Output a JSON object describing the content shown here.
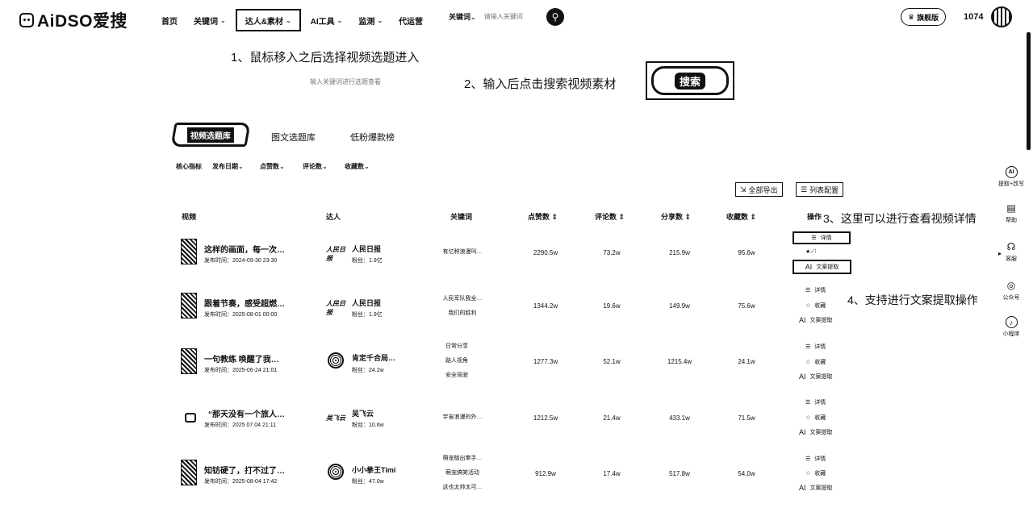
{
  "brand": {
    "logo_text": "AiDSO爱搜"
  },
  "nav": {
    "home": "首页",
    "keywords": "关键词",
    "creators": "达人&素材",
    "ai_tools": "AI工具",
    "monitor": "监测",
    "agency": "代运营"
  },
  "search": {
    "type_label": "关键词",
    "placeholder": "请输入关键词"
  },
  "user": {
    "vip_label": "旗舰版",
    "points": "1074"
  },
  "annotations": {
    "step1": "1、鼠标移入之后选择视频选题进入",
    "step1_hint": "输入关键词进行选题查看",
    "step2": "2、输入后点击搜索视频素材",
    "step2_button": "搜索",
    "step3": "3、这里可以进行查看视频详情",
    "step4": "4、支持进行文案提取操作"
  },
  "tabs": [
    "视频选题库",
    "图文选题库",
    "低粉爆款榜"
  ],
  "filters": [
    "核心指标",
    "发布日期",
    "点赞数",
    "评论数",
    "收藏数"
  ],
  "actions": {
    "export_all": "全部导出",
    "column_config": "列表配置"
  },
  "columns": [
    "视频",
    "达人",
    "关键词",
    "点赞数",
    "评论数",
    "分享数",
    "收藏数",
    "操作"
  ],
  "row_actions": {
    "detail": "详情",
    "favorite": "收藏",
    "extract": "文案提取"
  },
  "rows": [
    {
      "title": "这样的画面，每一次…",
      "date": "发布时间：2024-09-30 23:30",
      "author": "人民日报",
      "author_logo": "人民日报",
      "fans": "粉丝：1.9亿",
      "keywords": [
        "有亿种浪漫叫…"
      ],
      "likes": "2290.5w",
      "comments": "73.2w",
      "shares": "215.9w",
      "favs": "95.6w"
    },
    {
      "title": "跟着节奏，感受超燃…",
      "date": "发布时间：2025-08-01 00:00",
      "author": "人民日报",
      "author_logo": "人民日报",
      "fans": "粉丝：1.9亿",
      "keywords": [
        "人民军队我全…",
        "我们的胜利"
      ],
      "likes": "1344.2w",
      "comments": "19.6w",
      "shares": "149.9w",
      "favs": "75.6w"
    },
    {
      "title": "一句教练 唤醒了我…",
      "date": "发布时间：2025-06-24 21:01",
      "author": "肯定千合局…",
      "author_logo": "",
      "fans": "粉丝：24.2w",
      "keywords": [
        "日常分享",
        "路人视角",
        "安全驾驶"
      ],
      "likes": "1277.3w",
      "comments": "52.1w",
      "shares": "1215.4w",
      "favs": "24.1w"
    },
    {
      "title": "“那天没有一个旅人…",
      "date": "发布时间：2025 07 04 21:11",
      "author": "吴飞云",
      "author_logo": "吴飞云",
      "fans": "粉丝：10.6w",
      "keywords": [
        "宇宙浪漫的外…"
      ],
      "likes": "1212.5w",
      "comments": "21.4w",
      "shares": "433.1w",
      "favs": "71.5w"
    },
    {
      "title": "知钫硬了，打不过了…",
      "date": "发布时间：2025-08-04 17:42",
      "author": "小小拳王Timi",
      "author_logo": "",
      "fans": "粉丝：47.0w",
      "keywords": [
        "萌宠版出拳手…",
        "萌宠搞笑活动",
        "这也太帅太可…"
      ],
      "likes": "912.9w",
      "comments": "17.4w",
      "shares": "517.8w",
      "favs": "54.0w"
    }
  ],
  "sidebar": [
    "提取+改写",
    "帮助",
    "客服",
    "公众号",
    "小程序"
  ]
}
